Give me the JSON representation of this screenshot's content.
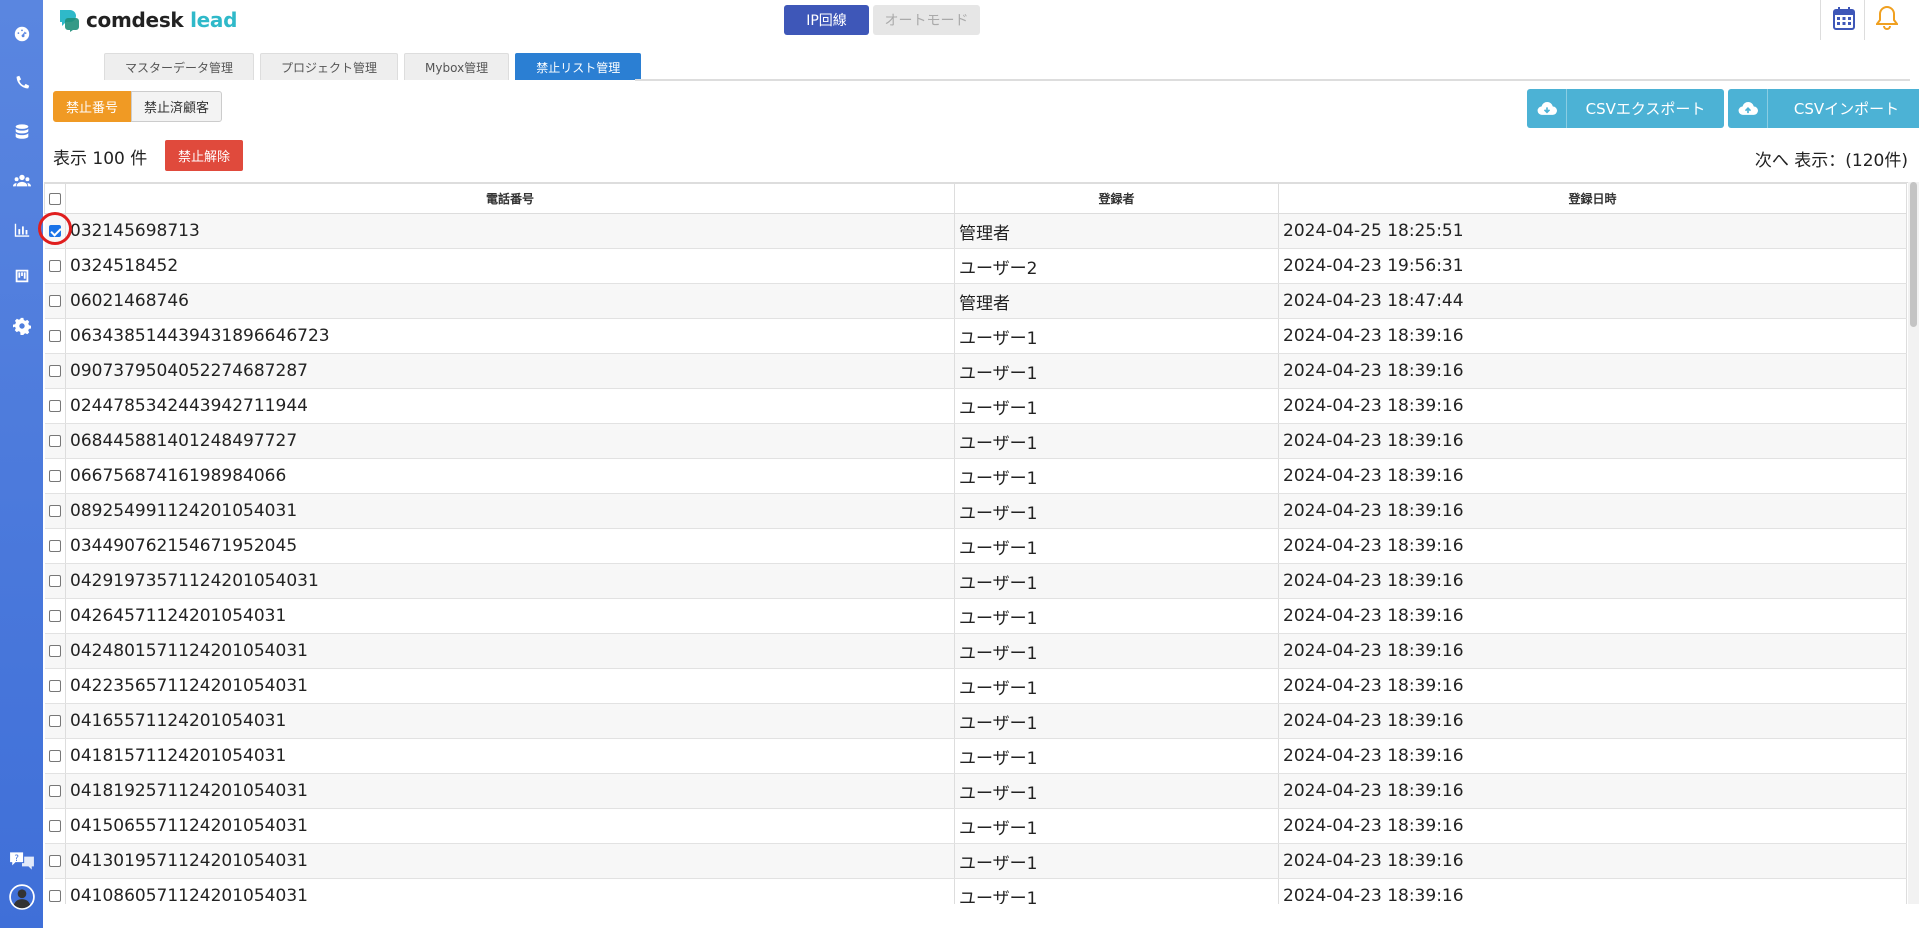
{
  "app": {
    "logo_main": "comdesk",
    "logo_accent": "lead"
  },
  "header": {
    "ip_button": "IP回線",
    "auto_button": "オートモード"
  },
  "sidebar": {
    "icons": [
      "dashboard-icon",
      "phone-icon",
      "database-icon",
      "users-icon",
      "chart-icon",
      "board-icon",
      "gear-icon"
    ],
    "bottom_icons": [
      "help-chat-icon",
      "account-icon"
    ]
  },
  "tabs": [
    {
      "label": "マスターデータ管理",
      "active": false
    },
    {
      "label": "プロジェクト管理",
      "active": false
    },
    {
      "label": "Mybox管理",
      "active": false
    },
    {
      "label": "禁止リスト管理",
      "active": true
    }
  ],
  "filter": {
    "on_label": "禁止番号",
    "off_label": "禁止済顧客"
  },
  "actions": {
    "export_label": "CSVエクスポート",
    "import_label": "CSVインポート",
    "release_label": "禁止解除"
  },
  "count_text": "表示 100 件",
  "paging_text": "次へ 表示：(120件)",
  "table": {
    "headers": [
      "電話番号",
      "登録者",
      "登録日時"
    ],
    "rows": [
      {
        "phone": "032145698713",
        "user": "管理者",
        "date": "2024-04-25 18:25:51",
        "checked": true
      },
      {
        "phone": "0324518452",
        "user": "ユーザー2",
        "date": "2024-04-23 19:56:31",
        "checked": false
      },
      {
        "phone": "06021468746",
        "user": "管理者",
        "date": "2024-04-23 18:47:44",
        "checked": false
      },
      {
        "phone": "0634385144394318966467­23",
        "user": "ユーザー1",
        "date": "2024-04-23 18:39:16",
        "checked": false
      },
      {
        "phone": "0907379504052274687287",
        "user": "ユーザー1",
        "date": "2024-04-23 18:39:16",
        "checked": false
      },
      {
        "phone": "02447853424439427119­44",
        "user": "ユーザー1",
        "date": "2024-04-23 18:39:16",
        "checked": false
      },
      {
        "phone": "068445881401248497727",
        "user": "ユーザー1",
        "date": "2024-04-23 18:39:16",
        "checked": false
      },
      {
        "phone": "06675687416198984066",
        "user": "ユーザー1",
        "date": "2024-04-23 18:39:16",
        "checked": false
      },
      {
        "phone": "089254991124201054031",
        "user": "ユーザー1",
        "date": "2024-04-23 18:39:16",
        "checked": false
      },
      {
        "phone": "034490762154671952045",
        "user": "ユーザー1",
        "date": "2024-04-23 18:39:16",
        "checked": false
      },
      {
        "phone": "0429197357112420105403­1",
        "user": "ユーザー1",
        "date": "2024-04-23 18:39:16",
        "checked": false
      },
      {
        "phone": "042645711242010540­31",
        "user": "ユーザー1",
        "date": "2024-04-23 18:39:16",
        "checked": false
      },
      {
        "phone": "042480157112420105403­1",
        "user": "ユーザー1",
        "date": "2024-04-23 18:39:16",
        "checked": false
      },
      {
        "phone": "042235657112420105403­1",
        "user": "ユーザー1",
        "date": "2024-04-23 18:39:16",
        "checked": false
      },
      {
        "phone": "041655711242010540­31",
        "user": "ユーザー1",
        "date": "2024-04-23 18:39:16",
        "checked": false
      },
      {
        "phone": "041815711242010540­31",
        "user": "ユーザー1",
        "date": "2024-04-23 18:39:16",
        "checked": false
      },
      {
        "phone": "041819257112420105403­1",
        "user": "ユーザー1",
        "date": "2024-04-23 18:39:16",
        "checked": false
      },
      {
        "phone": "041506557112420105403­1",
        "user": "ユーザー1",
        "date": "2024-04-23 18:39:16",
        "checked": false
      },
      {
        "phone": "041301957112420105403­1",
        "user": "ユーザー1",
        "date": "2024-04-23 18:39:16",
        "checked": false
      },
      {
        "phone": "041086057112420105403­1",
        "user": "ユーザー1",
        "date": "2024-04-23 18:39:16",
        "checked": false
      }
    ]
  },
  "colors": {
    "sidebar": "#4a7ae0",
    "accent_orange": "#f09a24",
    "danger": "#e04a3c",
    "csv": "#4cb2d5",
    "tab_active": "#2b7fd3"
  }
}
